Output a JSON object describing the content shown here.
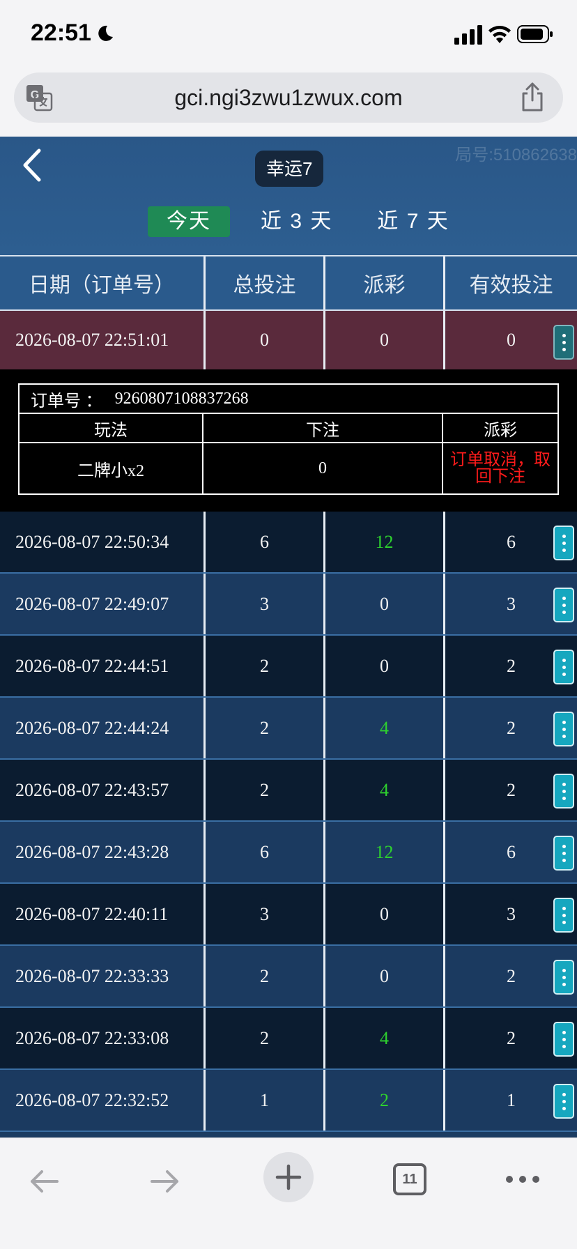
{
  "status_bar": {
    "time": "22:51"
  },
  "browser": {
    "url": "gci.ngi3zwu1zwux.com",
    "tab_count": "11"
  },
  "header": {
    "title": "幸运7",
    "ghost_text": "局号:510862638",
    "range_tabs": [
      "今天",
      "近 3 天",
      "近 7 天"
    ],
    "active_tab": "今天"
  },
  "table": {
    "columns": [
      "日期（订单号）",
      "总投注",
      "派彩",
      "有效投注"
    ],
    "rows": [
      {
        "date": "2026-08-07 22:51:01",
        "total": "0",
        "payout": "0",
        "valid": "0"
      },
      {
        "date": "2026-08-07 22:50:34",
        "total": "6",
        "payout": "12",
        "valid": "6"
      },
      {
        "date": "2026-08-07 22:49:07",
        "total": "3",
        "payout": "0",
        "valid": "3"
      },
      {
        "date": "2026-08-07 22:44:51",
        "total": "2",
        "payout": "0",
        "valid": "2"
      },
      {
        "date": "2026-08-07 22:44:24",
        "total": "2",
        "payout": "4",
        "valid": "2"
      },
      {
        "date": "2026-08-07 22:43:57",
        "total": "2",
        "payout": "4",
        "valid": "2"
      },
      {
        "date": "2026-08-07 22:43:28",
        "total": "6",
        "payout": "12",
        "valid": "6"
      },
      {
        "date": "2026-08-07 22:40:11",
        "total": "3",
        "payout": "0",
        "valid": "3"
      },
      {
        "date": "2026-08-07 22:33:33",
        "total": "2",
        "payout": "0",
        "valid": "2"
      },
      {
        "date": "2026-08-07 22:33:08",
        "total": "2",
        "payout": "4",
        "valid": "2"
      },
      {
        "date": "2026-08-07 22:32:52",
        "total": "1",
        "payout": "2",
        "valid": "1"
      }
    ]
  },
  "detail": {
    "order_label": "订单号 ：",
    "order_no": "9260807108837268",
    "columns": [
      "玩法",
      "下注",
      "派彩"
    ],
    "play": "二牌小x2",
    "bet": "0",
    "payout": "订单取消，取回下注"
  },
  "colors": {
    "win_text": "#2ed12e",
    "cancel_text": "#ff1b1b",
    "active_tab_bg": "#1f8a55",
    "menu_button": "#16a7bf"
  }
}
